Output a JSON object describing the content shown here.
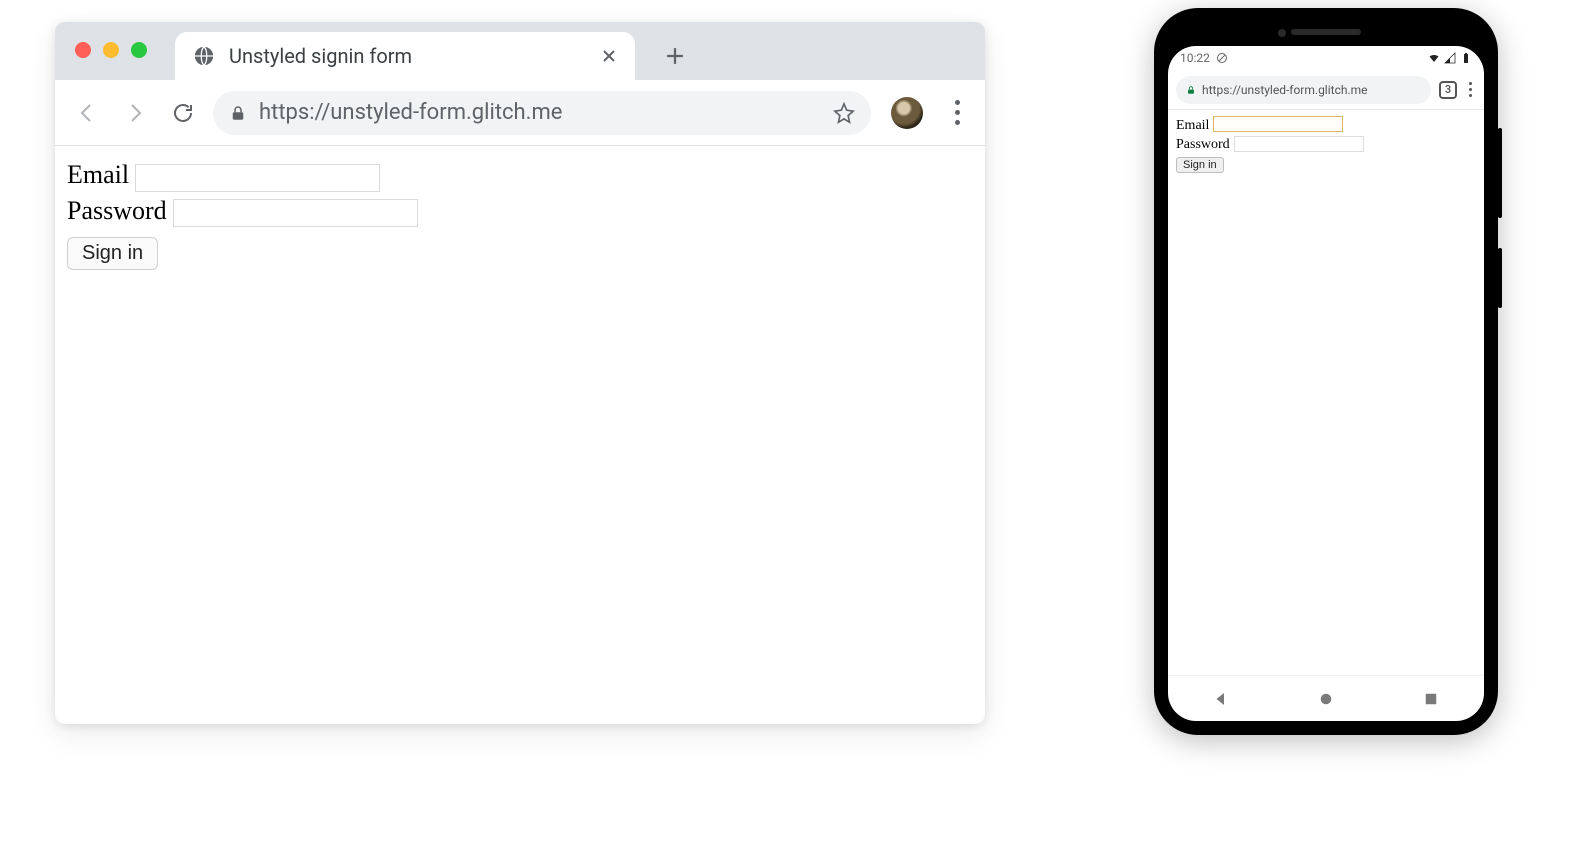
{
  "desktop": {
    "tab_title": "Unstyled signin form",
    "url": "https://unstyled-form.glitch.me",
    "form": {
      "email_label": "Email",
      "password_label": "Password",
      "submit_label": "Sign in"
    }
  },
  "mobile": {
    "status_time": "10:22",
    "url": "https://unstyled-form.glitch.me",
    "tab_count": "3",
    "form": {
      "email_label": "Email",
      "password_label": "Password",
      "submit_label": "Sign in"
    }
  }
}
